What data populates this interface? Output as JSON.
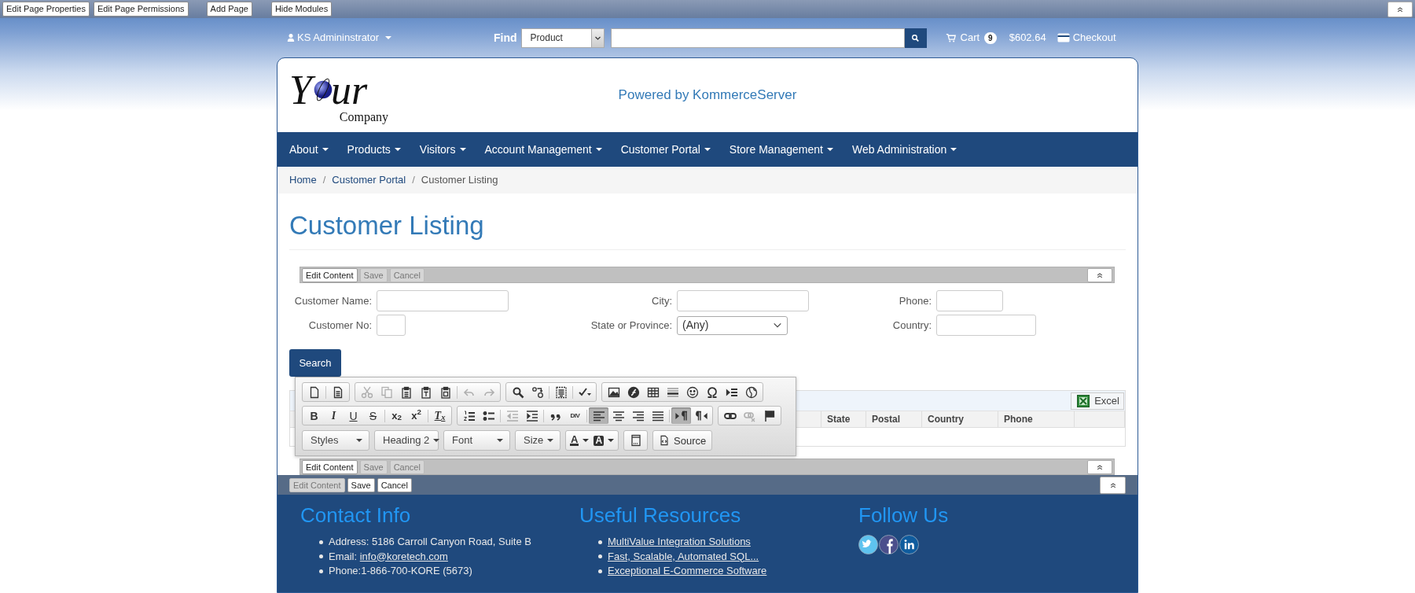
{
  "admin_bar": {
    "buttons": [
      "Edit Page Properties",
      "Edit Page Permissions",
      "Add Page",
      "Hide Modules"
    ]
  },
  "header": {
    "user": "KS Admininstrator",
    "find_label": "Find",
    "find_scope": "Product",
    "cart_label": "Cart",
    "cart_count": "9",
    "cart_total": "$602.64",
    "checkout": "Checkout"
  },
  "logo": {
    "first_letter": "Y",
    "letters": "ur",
    "company": "Company"
  },
  "tagline": "Powered by KommerceServer",
  "nav": [
    "About",
    "Products",
    "Visitors",
    "Account Management",
    "Customer Portal",
    "Store Management",
    "Web Administration"
  ],
  "breadcrumb": [
    {
      "label": "Home",
      "current": false,
      "separator": "/"
    },
    {
      "label": "Customer Portal",
      "current": false,
      "separator": "/"
    },
    {
      "label": "Customer Listing",
      "current": true
    }
  ],
  "page_title": "Customer Listing",
  "edit_bar_top": [
    {
      "label": "Edit Content",
      "disabled": false
    },
    {
      "label": "Save",
      "disabled": true
    },
    {
      "label": "Cancel",
      "disabled": true
    }
  ],
  "search_form": {
    "fields": [
      {
        "label": "Customer Name:",
        "kind": "text"
      },
      {
        "label": "City:",
        "kind": "text"
      },
      {
        "label": "Phone:",
        "kind": "text"
      },
      {
        "label": "Customer No:",
        "kind": "text"
      },
      {
        "label": "State or Province:",
        "kind": "select",
        "value": "(Any)"
      },
      {
        "label": "Country:",
        "kind": "text"
      }
    ],
    "button": "Search"
  },
  "editor_toolbar": {
    "rows": [
      {
        "groups": [
          {
            "sections": [
              {
                "buttons": [
                  {
                    "kind": "icon",
                    "disabled": false,
                    "selected": false
                  }
                ]
              },
              {
                "buttons": [
                  {
                    "kind": "icon",
                    "disabled": false,
                    "selected": false
                  }
                ]
              }
            ]
          },
          {
            "sections": [
              {
                "buttons": [
                  {
                    "kind": "icon",
                    "disabled": true,
                    "selected": false
                  },
                  {
                    "kind": "icon",
                    "disabled": true,
                    "selected": false
                  },
                  {
                    "kind": "icon",
                    "disabled": false,
                    "selected": false
                  },
                  {
                    "kind": "icon",
                    "disabled": false,
                    "selected": false
                  },
                  {
                    "kind": "icon",
                    "disabled": false,
                    "selected": false
                  }
                ]
              },
              {
                "buttons": [
                  {
                    "kind": "icon",
                    "disabled": true,
                    "selected": false
                  },
                  {
                    "kind": "icon",
                    "disabled": true,
                    "selected": false
                  }
                ]
              }
            ]
          },
          {
            "sections": [
              {
                "buttons": [
                  {
                    "kind": "icon",
                    "disabled": false,
                    "selected": false
                  },
                  {
                    "kind": "icon",
                    "disabled": false,
                    "selected": false
                  }
                ]
              },
              {
                "buttons": [
                  {
                    "kind": "icon",
                    "disabled": false,
                    "selected": false
                  }
                ]
              },
              {
                "buttons": [
                  {
                    "kind": "icon",
                    "disabled": false,
                    "selected": false
                  }
                ]
              }
            ]
          },
          {
            "sections": [
              {
                "buttons": [
                  {
                    "kind": "icon",
                    "disabled": false,
                    "selected": false
                  },
                  {
                    "kind": "icon",
                    "disabled": false,
                    "selected": false
                  },
                  {
                    "kind": "icon",
                    "disabled": false,
                    "selected": false
                  },
                  {
                    "kind": "icon",
                    "disabled": false,
                    "selected": false
                  },
                  {
                    "kind": "icon",
                    "disabled": false,
                    "selected": false
                  },
                  {
                    "kind": "icon",
                    "disabled": false,
                    "selected": false
                  },
                  {
                    "kind": "icon",
                    "disabled": false,
                    "selected": false
                  },
                  {
                    "kind": "icon",
                    "disabled": false,
                    "selected": false
                  }
                ]
              }
            ]
          }
        ]
      },
      {
        "groups": [
          {
            "sections": [
              {
                "buttons": [
                  {
                    "kind": "bold",
                    "label": "B",
                    "disabled": false,
                    "selected": false
                  },
                  {
                    "kind": "italic",
                    "label": "I",
                    "disabled": false,
                    "selected": false
                  },
                  {
                    "kind": "underline",
                    "label": "U",
                    "disabled": false,
                    "selected": false
                  },
                  {
                    "kind": "strike",
                    "label": "S",
                    "disabled": false,
                    "selected": false
                  }
                ]
              },
              {
                "buttons": [
                  {
                    "kind": "script",
                    "label": "x$_{2}$",
                    "disabled": false,
                    "selected": false
                  },
                  {
                    "kind": "script",
                    "label": "x$^{2}$",
                    "disabled": false,
                    "selected": false
                  }
                ]
              },
              {
                "buttons": [
                  {
                    "kind": "clear",
                    "label": "T$_{x}$",
                    "disabled": false,
                    "selected": false
                  }
                ]
              }
            ]
          },
          {
            "sections": [
              {
                "buttons": [
                  {
                    "kind": "icon",
                    "disabled": false,
                    "selected": false
                  },
                  {
                    "kind": "icon",
                    "disabled": false,
                    "selected": false
                  }
                ]
              },
              {
                "buttons": [
                  {
                    "kind": "icon",
                    "disabled": true,
                    "selected": false
                  },
                  {
                    "kind": "icon",
                    "disabled": false,
                    "selected": false
                  }
                ]
              },
              {
                "buttons": [
                  {
                    "kind": "icon",
                    "disabled": false,
                    "selected": false
                  },
                  {
                    "kind": "tiny",
                    "label": "DIV",
                    "disabled": false,
                    "selected": false
                  }
                ]
              },
              {
                "buttons": [
                  {
                    "kind": "icon",
                    "disabled": false,
                    "selected": true
                  },
                  {
                    "kind": "icon",
                    "disabled": false,
                    "selected": false
                  },
                  {
                    "kind": "icon",
                    "disabled": false,
                    "selected": false
                  },
                  {
                    "kind": "icon",
                    "disabled": false,
                    "selected": false
                  }
                ]
              },
              {
                "buttons": [
                  {
                    "kind": "icon",
                    "disabled": false,
                    "selected": true
                  },
                  {
                    "kind": "icon",
                    "disabled": false,
                    "selected": false
                  }
                ]
              }
            ]
          },
          {
            "sections": [
              {
                "buttons": [
                  {
                    "kind": "icon",
                    "disabled": false,
                    "selected": false
                  },
                  {
                    "kind": "icon",
                    "disabled": true,
                    "selected": false
                  },
                  {
                    "kind": "icon",
                    "disabled": false,
                    "selected": false
                  }
                ]
              }
            ]
          }
        ]
      },
      {
        "groups": [
          {
            "sections": [
              {
                "buttons": [
                  {
                    "kind": "combo",
                    "label": "Styles"
                  }
                ]
              }
            ]
          },
          {
            "sections": [
              {
                "buttons": [
                  {
                    "kind": "combo",
                    "label": "Heading 2"
                  }
                ]
              }
            ]
          },
          {
            "sections": [
              {
                "buttons": [
                  {
                    "kind": "combo",
                    "label": "Font"
                  }
                ]
              }
            ]
          },
          {
            "sections": [
              {
                "buttons": [
                  {
                    "kind": "combo",
                    "label": "Size"
                  }
                ]
              }
            ]
          },
          {
            "sections": [
              {
                "buttons": [
                  {
                    "kind": "color",
                    "label": "A"
                  },
                  {
                    "kind": "bgcolor",
                    "label": "A"
                  }
                ]
              }
            ]
          },
          {
            "sections": [
              {
                "buttons": [
                  {
                    "kind": "blocks"
                  }
                ]
              }
            ]
          },
          {
            "sections": [
              {
                "buttons": [
                  {
                    "kind": "source",
                    "label": "Source"
                  }
                ]
              }
            ]
          }
        ]
      }
    ]
  },
  "grid": {
    "export_button": "Excel",
    "columns": [
      "State",
      "Postal",
      "Country",
      "Phone"
    ]
  },
  "edit_bar_bottom": [
    {
      "label": "Edit Content",
      "disabled": false
    },
    {
      "label": "Save",
      "disabled": true
    },
    {
      "label": "Cancel",
      "disabled": true
    }
  ],
  "footer_bar": [
    {
      "label": "Edit Content",
      "disabled": true
    },
    {
      "label": "Save",
      "disabled": false
    },
    {
      "label": "Cancel",
      "disabled": false
    }
  ],
  "footer": [
    {
      "kind": "list",
      "title": "Contact Info",
      "items": [
        {
          "text": "Address: 5186 Carroll Canyon Road, Suite B"
        },
        {
          "text": "Email: ",
          "link": "info@koretech.com"
        },
        {
          "text": "Phone:1-866-700-KORE (5673)"
        }
      ]
    },
    {
      "kind": "list",
      "title": "Useful Resources",
      "items": [
        {
          "link": "MultiValue Integration Solutions"
        },
        {
          "link": "Fast, Scalable, Automated SQL..."
        },
        {
          "link": "Exceptional E-Commerce Software"
        }
      ]
    },
    {
      "kind": "social",
      "title": "Follow Us"
    }
  ]
}
